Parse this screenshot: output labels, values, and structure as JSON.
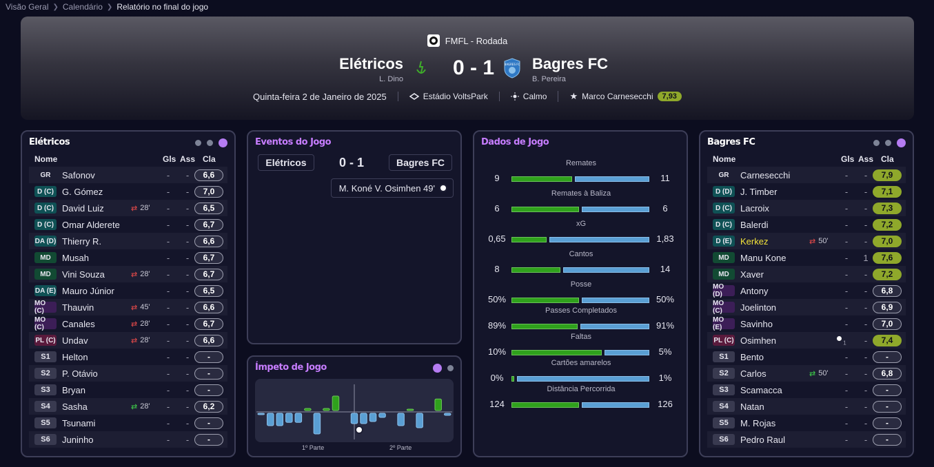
{
  "breadcrumb": [
    "Visão Geral",
    "Calendário",
    "Relatório no final do jogo"
  ],
  "match": {
    "competition": "FMFL - Rodada",
    "home_team": "Elétricos",
    "home_manager": "L. Dino",
    "away_team": "Bagres FC",
    "away_manager": "B. Pereira",
    "score": "0 - 1",
    "date": "Quinta-feira 2 de Janeiro de 2025",
    "stadium": "Estádio VoltsPark",
    "weather": "Calmo",
    "motm": "Marco Carnesecchi",
    "motm_rating": "7,93",
    "crest_label": "BAGRES FC"
  },
  "columns": {
    "name": "Nome",
    "goals": "Gls",
    "assists": "Ass",
    "rating": "Cla"
  },
  "home": {
    "title": "Elétricos",
    "players": [
      {
        "pos": "GR",
        "cls": "gr",
        "name": "Safonov",
        "sub": "",
        "g": "-",
        "a": "-",
        "r": "6,6"
      },
      {
        "pos": "D (C)",
        "cls": "d",
        "name": "G. Gómez",
        "sub": "",
        "g": "-",
        "a": "-",
        "r": "7,0"
      },
      {
        "pos": "D (C)",
        "cls": "d",
        "name": "David Luiz",
        "sub": "28'",
        "subdir": "out",
        "g": "-",
        "a": "-",
        "r": "6,5"
      },
      {
        "pos": "D (C)",
        "cls": "d",
        "name": "Omar Alderete",
        "sub": "",
        "g": "-",
        "a": "-",
        "r": "6,7"
      },
      {
        "pos": "DA (D)",
        "cls": "d",
        "name": "Thierry R.",
        "sub": "",
        "g": "-",
        "a": "-",
        "r": "6,6"
      },
      {
        "pos": "MD",
        "cls": "md",
        "name": "Musah",
        "sub": "",
        "g": "-",
        "a": "-",
        "r": "6,7"
      },
      {
        "pos": "MD",
        "cls": "md",
        "name": "Vini Souza",
        "sub": "28'",
        "subdir": "out",
        "g": "-",
        "a": "-",
        "r": "6,7"
      },
      {
        "pos": "DA (E)",
        "cls": "d",
        "name": "Mauro Júnior",
        "sub": "",
        "g": "-",
        "a": "-",
        "r": "6,5"
      },
      {
        "pos": "MO (C)",
        "cls": "mo",
        "name": "Thauvin",
        "sub": "45'",
        "subdir": "out",
        "g": "-",
        "a": "-",
        "r": "6,6"
      },
      {
        "pos": "MO (C)",
        "cls": "mo",
        "name": "Canales",
        "sub": "28'",
        "subdir": "out",
        "g": "-",
        "a": "-",
        "r": "6,7"
      },
      {
        "pos": "PL (C)",
        "cls": "pl",
        "name": "Undav",
        "sub": "28'",
        "subdir": "out",
        "g": "-",
        "a": "-",
        "r": "6,6"
      },
      {
        "pos": "S1",
        "cls": "sub",
        "name": "Helton",
        "sub": "",
        "g": "-",
        "a": "-",
        "r": "-"
      },
      {
        "pos": "S2",
        "cls": "sub",
        "name": "P. Otávio",
        "sub": "",
        "g": "-",
        "a": "-",
        "r": "-"
      },
      {
        "pos": "S3",
        "cls": "sub",
        "name": "Bryan",
        "sub": "",
        "g": "-",
        "a": "-",
        "r": "-"
      },
      {
        "pos": "S4",
        "cls": "sub",
        "name": "Sasha",
        "sub": "28'",
        "subdir": "in",
        "g": "-",
        "a": "-",
        "r": "6,2"
      },
      {
        "pos": "S5",
        "cls": "sub",
        "name": "Tsunami",
        "sub": "",
        "g": "-",
        "a": "-",
        "r": "-"
      },
      {
        "pos": "S6",
        "cls": "sub",
        "name": "Juninho",
        "sub": "",
        "g": "-",
        "a": "-",
        "r": "-"
      }
    ]
  },
  "away": {
    "title": "Bagres FC",
    "players": [
      {
        "pos": "GR",
        "cls": "gr",
        "name": "Carnesecchi",
        "sub": "",
        "g": "-",
        "a": "-",
        "r": "7,9",
        "hi": true
      },
      {
        "pos": "D (D)",
        "cls": "d",
        "name": "J. Timber",
        "sub": "",
        "g": "-",
        "a": "-",
        "r": "7,1",
        "hi": true
      },
      {
        "pos": "D (C)",
        "cls": "d",
        "name": "Lacroix",
        "sub": "",
        "g": "-",
        "a": "-",
        "r": "7,3",
        "hi": true
      },
      {
        "pos": "D (C)",
        "cls": "d",
        "name": "Balerdi",
        "sub": "",
        "g": "-",
        "a": "-",
        "r": "7,2",
        "hi": true
      },
      {
        "pos": "D (E)",
        "cls": "d",
        "name": "Kerkez",
        "sub": "50'",
        "subdir": "out",
        "g": "-",
        "a": "-",
        "r": "7,0",
        "hi": true,
        "yellow": true
      },
      {
        "pos": "MD",
        "cls": "md",
        "name": "Manu Kone",
        "sub": "",
        "g": "-",
        "a": "1",
        "r": "7,6",
        "hi": true
      },
      {
        "pos": "MD",
        "cls": "md",
        "name": "Xaver",
        "sub": "",
        "g": "-",
        "a": "-",
        "r": "7,2",
        "hi": true
      },
      {
        "pos": "MO (D)",
        "cls": "mo",
        "name": "Antony",
        "sub": "",
        "g": "-",
        "a": "-",
        "r": "6,8"
      },
      {
        "pos": "MO (C)",
        "cls": "mo",
        "name": "Joelinton",
        "sub": "",
        "g": "-",
        "a": "-",
        "r": "6,9"
      },
      {
        "pos": "MO (E)",
        "cls": "mo",
        "name": "Savinho",
        "sub": "",
        "g": "-",
        "a": "-",
        "r": "7,0"
      },
      {
        "pos": "PL (C)",
        "cls": "pl",
        "name": "Osimhen",
        "sub": "",
        "goal": true,
        "g": "",
        "a": "-",
        "r": "7,4",
        "hi": true
      },
      {
        "pos": "S1",
        "cls": "sub",
        "name": "Bento",
        "sub": "",
        "g": "-",
        "a": "-",
        "r": "-"
      },
      {
        "pos": "S2",
        "cls": "sub",
        "name": "Carlos",
        "sub": "50'",
        "subdir": "in",
        "g": "-",
        "a": "-",
        "r": "6,8"
      },
      {
        "pos": "S3",
        "cls": "sub",
        "name": "Scamacca",
        "sub": "",
        "g": "-",
        "a": "-",
        "r": "-"
      },
      {
        "pos": "S4",
        "cls": "sub",
        "name": "Natan",
        "sub": "",
        "g": "-",
        "a": "-",
        "r": "-"
      },
      {
        "pos": "S5",
        "cls": "sub",
        "name": "M. Rojas",
        "sub": "",
        "g": "-",
        "a": "-",
        "r": "-"
      },
      {
        "pos": "S6",
        "cls": "sub",
        "name": "Pedro Raul",
        "sub": "",
        "g": "-",
        "a": "-",
        "r": "-"
      }
    ]
  },
  "events": {
    "title": "Eventos do Jogo",
    "home": "Elétricos",
    "score": "0 - 1",
    "away": "Bagres FC",
    "goal_text": "M. Koné  V. Osimhen 49'"
  },
  "momentum": {
    "title": "Ímpeto de Jogo",
    "half1": "1º Parte",
    "half2": "2º Parte",
    "home_values": [
      0,
      0,
      0,
      0,
      0,
      0.05,
      0,
      0.05,
      0.35,
      0,
      0,
      0,
      0,
      0,
      0,
      0,
      0.03,
      0,
      0,
      0.28,
      0
    ],
    "away_values": [
      0.03,
      0.3,
      0.3,
      0.22,
      0.22,
      0,
      0.5,
      0,
      0,
      0,
      0.25,
      0.25,
      0.2,
      0.1,
      0,
      0.3,
      0,
      0.35,
      0,
      0,
      0.05
    ]
  },
  "stats": {
    "title": "Dados de Jogo",
    "items": [
      {
        "label": "Remates",
        "home": "9",
        "away": "11",
        "hf": 0.45
      },
      {
        "label": "Remates à Baliza",
        "home": "6",
        "away": "6",
        "hf": 0.5
      },
      {
        "label": "xG",
        "home": "0,65",
        "away": "1,83",
        "hf": 0.26
      },
      {
        "label": "Cantos",
        "home": "8",
        "away": "14",
        "hf": 0.36
      },
      {
        "label": "Posse",
        "home": "50%",
        "away": "50%",
        "hf": 0.5
      },
      {
        "label": "Passes Completados",
        "home": "89%",
        "away": "91%",
        "hf": 0.49
      },
      {
        "label": "Faltas",
        "home": "10%",
        "away": "5%",
        "hf": 0.67
      },
      {
        "label": "Cartões amarelos",
        "home": "0%",
        "away": "1%",
        "hf": 0.02
      },
      {
        "label": "Distância Percorrida",
        "home": "124",
        "away": "126",
        "hf": 0.5
      }
    ]
  },
  "colors": {
    "accent": "#b57cf2",
    "title": "#c77dff",
    "rating_hi": "#8fa82b",
    "home_bar": "#2fa11c",
    "away_bar": "#5a9fd4"
  }
}
